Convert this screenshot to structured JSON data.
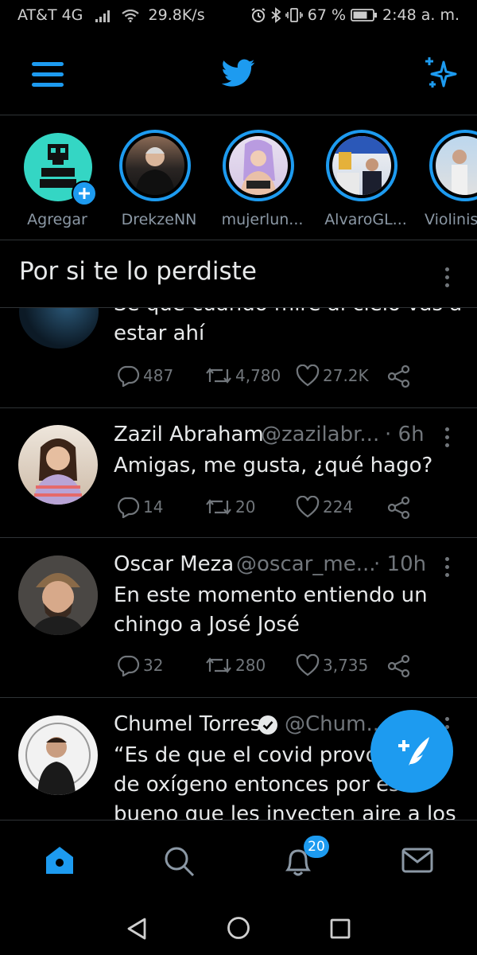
{
  "status_bar": {
    "carrier": "AT&T 4G",
    "speed": "29.8K/s",
    "battery": "67 %",
    "time": "2:48 a. m."
  },
  "header": {
    "menu_icon": "hamburger-menu-icon",
    "logo_icon": "twitter-bird-icon",
    "sparkle_icon": "sparkle-icon"
  },
  "fleets": [
    {
      "name": "Agregar",
      "add": true
    },
    {
      "name": "DrekzeNN"
    },
    {
      "name": "mujerlun..."
    },
    {
      "name": "AlvaroGL..."
    },
    {
      "name": "Violinis"
    }
  ],
  "section": {
    "title": "Por si te lo perdiste"
  },
  "tweets": [
    {
      "text_line1": "Se que cuando mire al cielo vas a",
      "text_line2": "estar ahí",
      "replies": "487",
      "retweets": "4,780",
      "likes": "27.2K"
    },
    {
      "name": "Zazil Abraham",
      "handle": "@zazilabr...",
      "time": "· 6h",
      "text_line1": "Amigas, me gusta, ¿qué hago?",
      "replies": "14",
      "retweets": "20",
      "likes": "224"
    },
    {
      "name": "Oscar Meza",
      "handle": "@oscar_me...",
      "time": "· 10h",
      "text_line1": "En este momento entiendo un",
      "text_line2": "chingo a José José",
      "replies": "32",
      "retweets": "280",
      "likes": "3,735"
    },
    {
      "name": "Chumel Torres",
      "handle": "@Chum...",
      "verified": true,
      "text_line1": "“Es de que el covid provoc",
      "text_line2": "de oxígeno entonces por eso",
      "text_line3": "bueno que les inyecten aire a los"
    }
  ],
  "bottom_nav": {
    "items": [
      "home-icon",
      "search-icon",
      "notifications-icon",
      "messages-icon"
    ],
    "notifications_badge": "20"
  },
  "colors": {
    "accent": "#1d9bf0",
    "background": "#000000",
    "muted": "#71767b"
  }
}
